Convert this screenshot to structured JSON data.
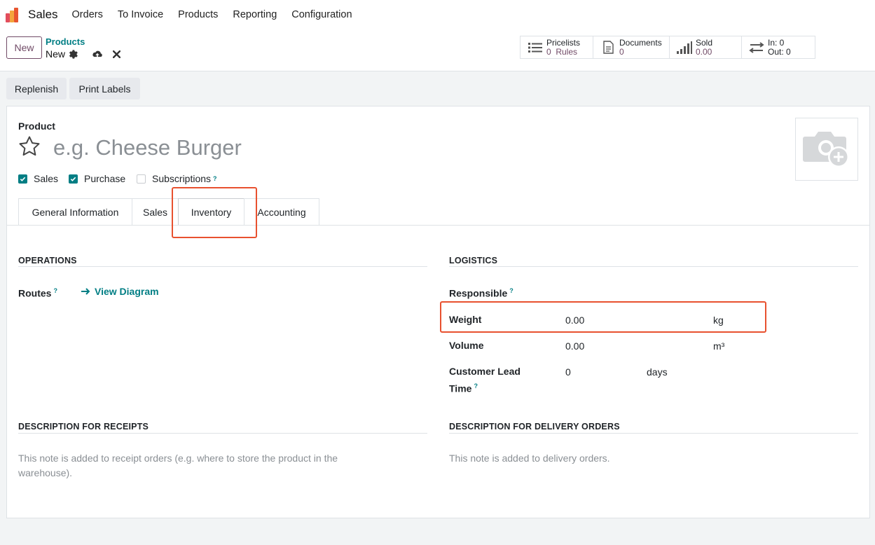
{
  "topbar": {
    "app_name": "Sales",
    "menu": [
      "Orders",
      "To Invoice",
      "Products",
      "Reporting",
      "Configuration"
    ]
  },
  "control": {
    "new_button": "New",
    "breadcrumb": "Products",
    "record_name": "New",
    "icons": [
      "gear-icon",
      "cloud-upload-icon",
      "close-icon"
    ]
  },
  "smart_buttons": [
    {
      "label": "Pricelists",
      "value": "0  Rules",
      "icon": "list-icon"
    },
    {
      "label": "Documents",
      "value": "0",
      "icon": "document-icon"
    },
    {
      "label": "Sold",
      "value": "0.00",
      "icon": "signal-icon"
    },
    {
      "label": "In: 0",
      "value": "Out: 0",
      "icon": "transfer-icon"
    }
  ],
  "actions": {
    "replenish": "Replenish",
    "print_labels": "Print Labels"
  },
  "form": {
    "product_label": "Product",
    "name_placeholder": "e.g. Cheese Burger",
    "checkboxes": [
      {
        "label": "Sales",
        "checked": true
      },
      {
        "label": "Purchase",
        "checked": true
      },
      {
        "label": "Subscriptions",
        "checked": false,
        "help": "?"
      }
    ],
    "tabs": [
      "General Information",
      "Sales",
      "Inventory",
      "Accounting"
    ],
    "active_tab": "Inventory"
  },
  "operations": {
    "title": "OPERATIONS",
    "routes_label": "Routes",
    "routes_help": "?",
    "view_diagram": "View Diagram"
  },
  "logistics": {
    "title": "LOGISTICS",
    "responsible_label": "Responsible",
    "help": "?",
    "weight_label": "Weight",
    "weight_value": "0.00",
    "weight_unit": "kg",
    "volume_label": "Volume",
    "volume_value": "0.00",
    "volume_unit": "m³",
    "lead_time_label_1": "Customer Lead",
    "lead_time_label_2": "Time",
    "lead_time_value": "0",
    "lead_time_unit": "days"
  },
  "descriptions": {
    "receipts_title": "DESCRIPTION FOR RECEIPTS",
    "receipts_placeholder_1": "This note is added to receipt orders (e.g. where to store the product in the",
    "receipts_placeholder_2": "warehouse).",
    "delivery_title": "DESCRIPTION FOR DELIVERY ORDERS",
    "delivery_placeholder": "This note is added to delivery orders."
  },
  "colors": {
    "brand": "#714b67",
    "accent": "#017e84",
    "highlight": "#e8512f"
  }
}
